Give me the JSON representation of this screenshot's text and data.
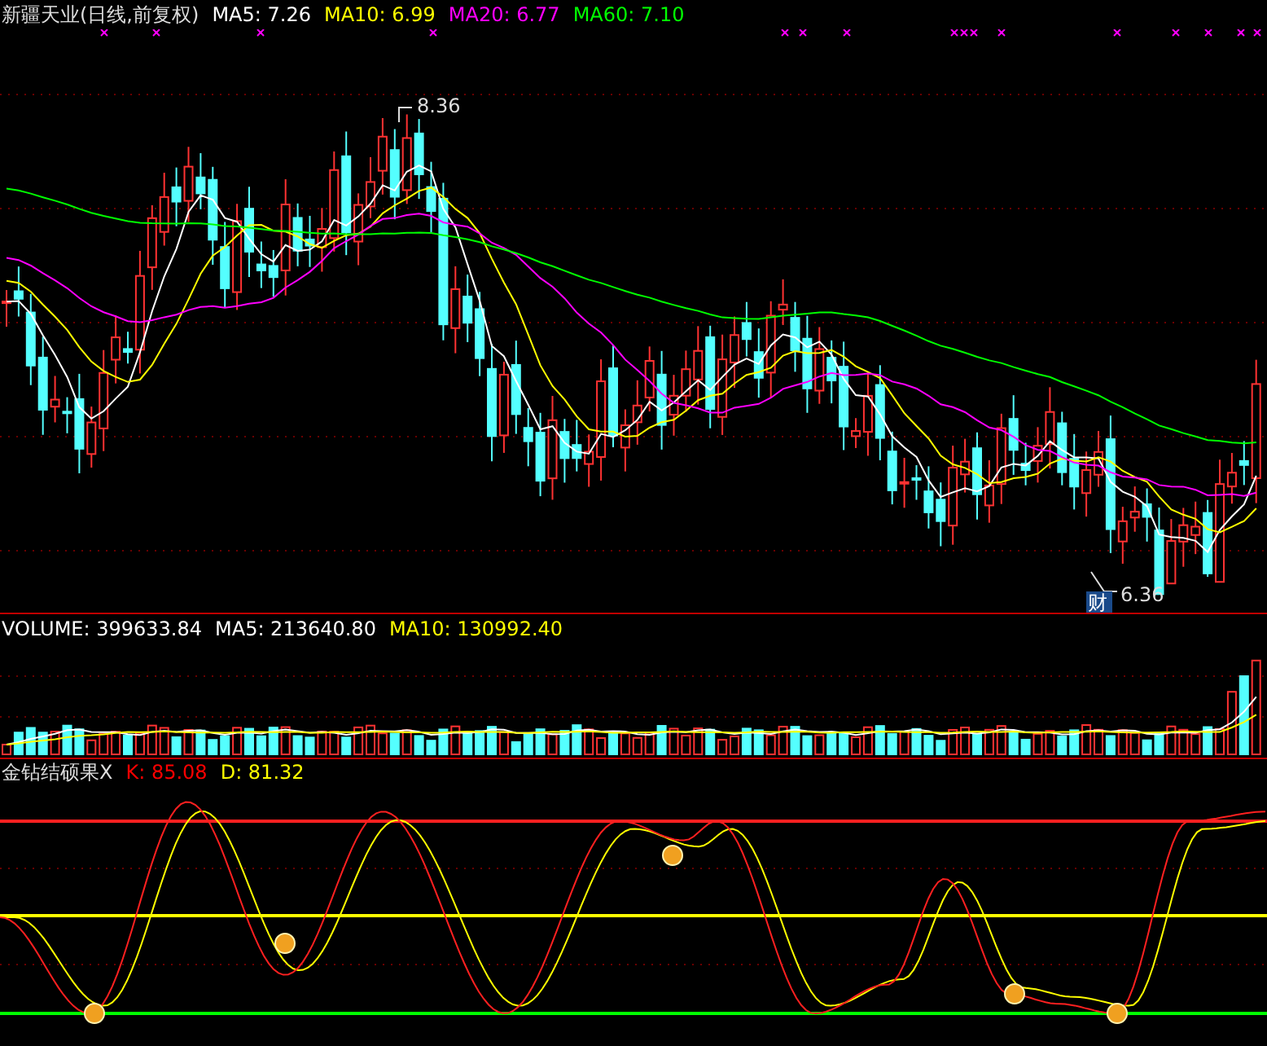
{
  "main_panel": {
    "title": "新疆天业(日线,前复权)",
    "indicators": [
      {
        "label": "MA5: 7.26",
        "color": "#ffffff"
      },
      {
        "label": "MA10: 6.99",
        "color": "#ffff00"
      },
      {
        "label": "MA20: 6.77",
        "color": "#ff00ff"
      },
      {
        "label": "MA60: 7.10",
        "color": "#00ff00"
      }
    ],
    "high_label": "8.36",
    "low_label": "6.36",
    "badge": "财"
  },
  "volume_panel": {
    "indicators": [
      {
        "label": "VOLUME: 399633.84",
        "color": "#ffffff"
      },
      {
        "label": "MA5: 213640.80",
        "color": "#ffffff"
      },
      {
        "label": "MA10: 130992.40",
        "color": "#ffff00"
      }
    ]
  },
  "oscillator_panel": {
    "title": "金钻结硕果X",
    "indicators": [
      {
        "label": "K: 85.08",
        "color": "#ff0000"
      },
      {
        "label": "D: 81.32",
        "color": "#ffff00"
      }
    ]
  }
}
